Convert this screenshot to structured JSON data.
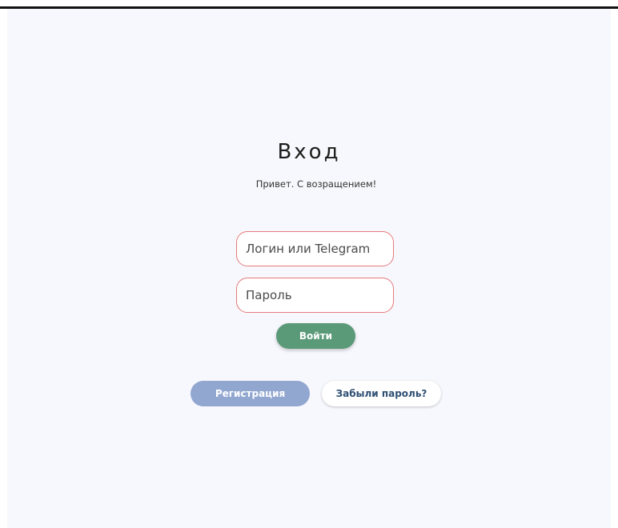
{
  "auth": {
    "title": "Вход",
    "subtitle": "Привет. С возращением!",
    "login_placeholder": "Логин или Telegram",
    "password_placeholder": "Пароль",
    "login_button": "Войти",
    "register_button": "Регистрация",
    "forgot_button": "Забыли пароль?"
  },
  "colors": {
    "background": "#f7f8fd",
    "field_border": "#e77a7a",
    "login_button": "#5a9a78",
    "register_button": "#91a7d0",
    "forgot_text": "#2f4f74"
  }
}
